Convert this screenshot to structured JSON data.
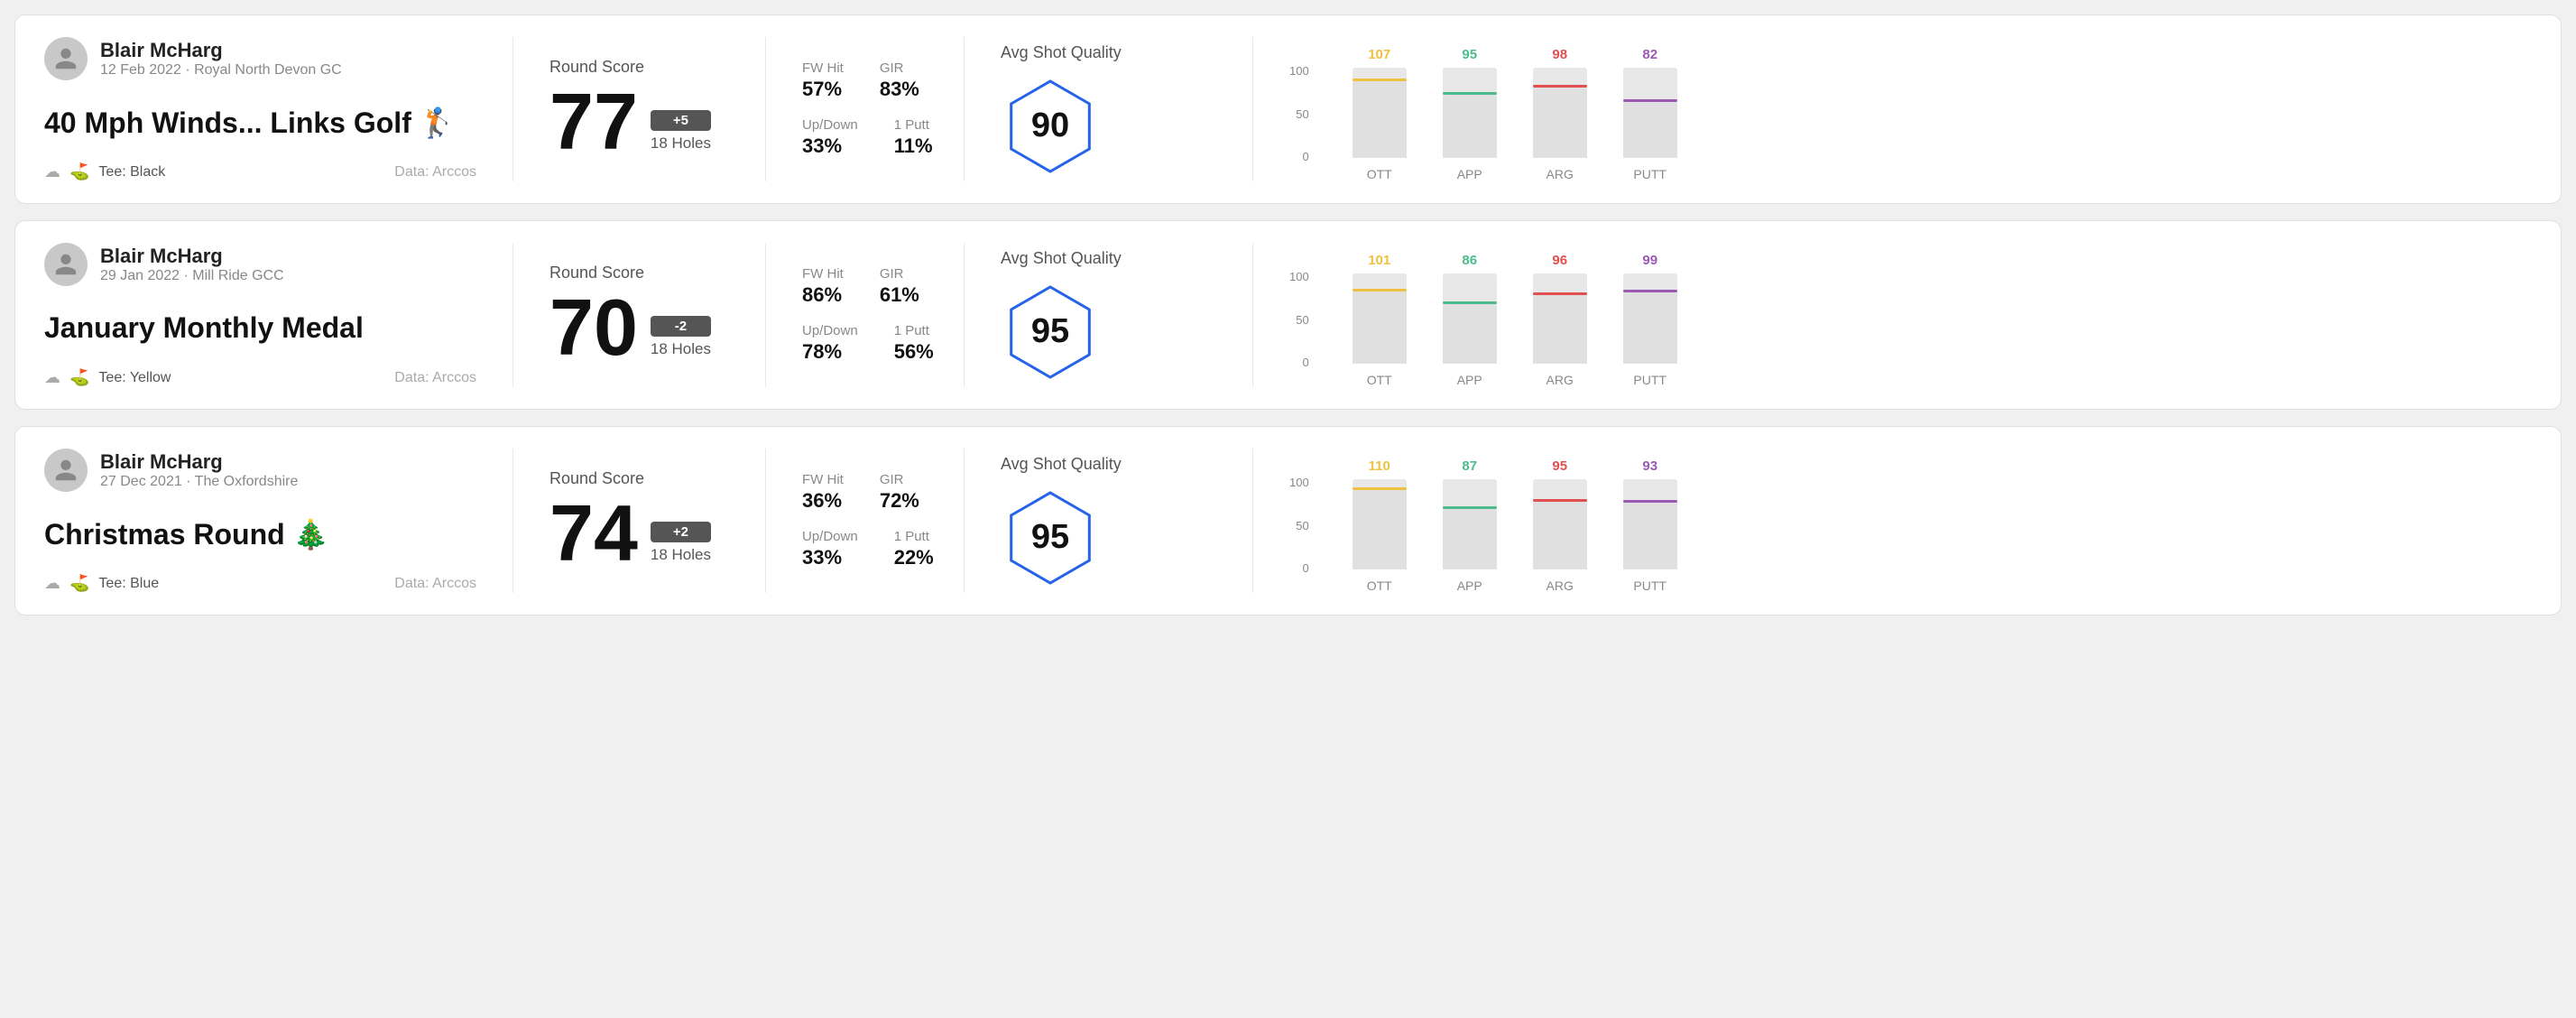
{
  "rounds": [
    {
      "id": "round1",
      "user": {
        "name": "Blair McHarg",
        "meta": "12 Feb 2022 · Royal North Devon GC"
      },
      "title": "40 Mph Winds... Links Golf 🏌️",
      "tee": "Black",
      "data_source": "Data: Arccos",
      "score": "77",
      "score_diff": "+5",
      "holes": "18 Holes",
      "fw_hit": "57%",
      "gir": "83%",
      "up_down": "33%",
      "one_putt": "11%",
      "avg_shot_quality": "90",
      "chart": {
        "bars": [
          {
            "label": "OTT",
            "value": 107,
            "color": "#f0c040",
            "pct": 85
          },
          {
            "label": "APP",
            "value": 95,
            "color": "#4cbc8c",
            "pct": 70
          },
          {
            "label": "ARG",
            "value": 98,
            "color": "#e05050",
            "pct": 78
          },
          {
            "label": "PUTT",
            "value": 82,
            "color": "#9b59b6",
            "pct": 62
          }
        ]
      }
    },
    {
      "id": "round2",
      "user": {
        "name": "Blair McHarg",
        "meta": "29 Jan 2022 · Mill Ride GCC"
      },
      "title": "January Monthly Medal",
      "tee": "Yellow",
      "data_source": "Data: Arccos",
      "score": "70",
      "score_diff": "-2",
      "holes": "18 Holes",
      "fw_hit": "86%",
      "gir": "61%",
      "up_down": "78%",
      "one_putt": "56%",
      "avg_shot_quality": "95",
      "chart": {
        "bars": [
          {
            "label": "OTT",
            "value": 101,
            "color": "#f0c040",
            "pct": 80
          },
          {
            "label": "APP",
            "value": 86,
            "color": "#4cbc8c",
            "pct": 66
          },
          {
            "label": "ARG",
            "value": 96,
            "color": "#e05050",
            "pct": 76
          },
          {
            "label": "PUTT",
            "value": 99,
            "color": "#9b59b6",
            "pct": 79
          }
        ]
      }
    },
    {
      "id": "round3",
      "user": {
        "name": "Blair McHarg",
        "meta": "27 Dec 2021 · The Oxfordshire"
      },
      "title": "Christmas Round 🎄",
      "tee": "Blue",
      "data_source": "Data: Arccos",
      "score": "74",
      "score_diff": "+2",
      "holes": "18 Holes",
      "fw_hit": "36%",
      "gir": "72%",
      "up_down": "33%",
      "one_putt": "22%",
      "avg_shot_quality": "95",
      "chart": {
        "bars": [
          {
            "label": "OTT",
            "value": 110,
            "color": "#f0c040",
            "pct": 88
          },
          {
            "label": "APP",
            "value": 87,
            "color": "#4cbc8c",
            "pct": 67
          },
          {
            "label": "ARG",
            "value": 95,
            "color": "#e05050",
            "pct": 75
          },
          {
            "label": "PUTT",
            "value": 93,
            "color": "#9b59b6",
            "pct": 74
          }
        ]
      }
    }
  ],
  "labels": {
    "round_score": "Round Score",
    "fw_hit": "FW Hit",
    "gir": "GIR",
    "up_down": "Up/Down",
    "one_putt": "1 Putt",
    "avg_shot_quality": "Avg Shot Quality",
    "tee_prefix": "Tee:",
    "y_axis": [
      "100",
      "50",
      "0"
    ]
  }
}
